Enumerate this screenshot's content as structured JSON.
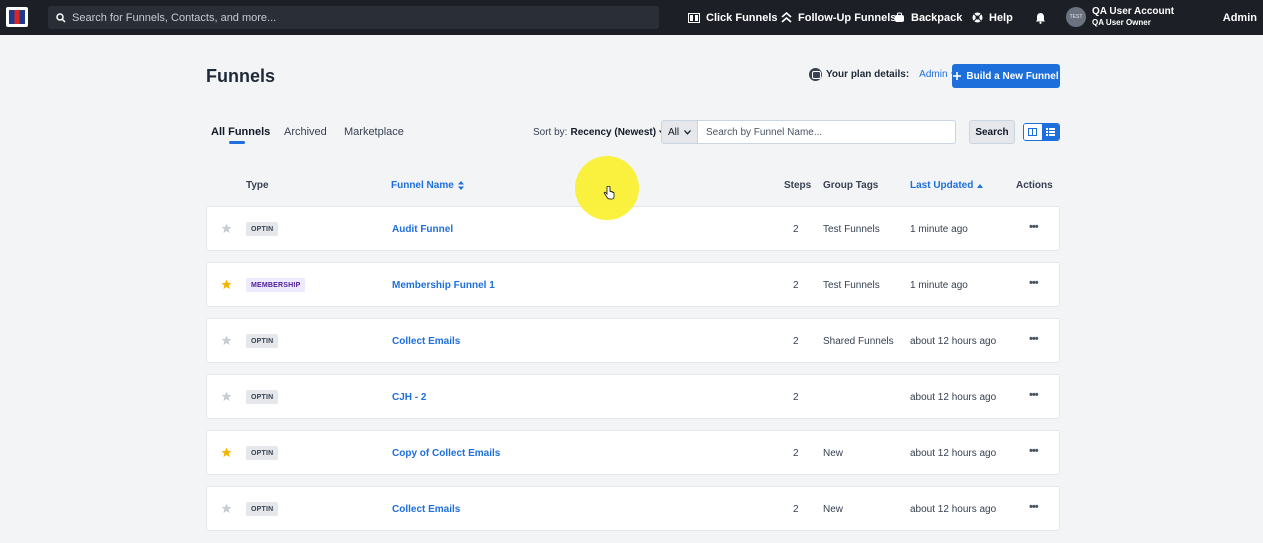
{
  "topnav": {
    "search_placeholder": "Search for Funnels, Contacts, and more...",
    "items": [
      {
        "label": "Click Funnels",
        "icon": "columns-icon"
      },
      {
        "label": "Follow-Up Funnels",
        "icon": "chevrons-up-icon"
      },
      {
        "label": "Backpack",
        "icon": "backpack-icon"
      },
      {
        "label": "Help",
        "icon": "help-icon"
      }
    ],
    "avatar_text": "TEST",
    "user_name": "QA User Account",
    "user_role": "QA User Owner",
    "admin_label": "Admin"
  },
  "header": {
    "title": "Funnels",
    "plan_label": "Your plan details:",
    "plan_value": "Admin",
    "build_button": "Build a New Funnel"
  },
  "tabs": [
    {
      "label": "All Funnels",
      "active": true
    },
    {
      "label": "Archived",
      "active": false
    },
    {
      "label": "Marketplace",
      "active": false
    }
  ],
  "toolbar": {
    "sort_label": "Sort by:",
    "sort_value": "Recency (Newest)",
    "filter_value": "All",
    "search_placeholder": "Search by Funnel Name...",
    "search_button": "Search"
  },
  "table": {
    "columns": [
      "Type",
      "Funnel Name",
      "Steps",
      "Group Tags",
      "Last Updated",
      "Actions"
    ],
    "rows": [
      {
        "starred": false,
        "type": "OPTIN",
        "name": "Audit Funnel",
        "steps": "2",
        "tags": "Test Funnels",
        "updated": "1 minute ago",
        "actions": "•••"
      },
      {
        "starred": true,
        "type": "MEMBERSHIP",
        "name": "Membership Funnel 1",
        "steps": "2",
        "tags": "Test Funnels",
        "updated": "1 minute ago",
        "actions": "•••"
      },
      {
        "starred": false,
        "type": "OPTIN",
        "name": "Collect Emails",
        "steps": "2",
        "tags": "Shared Funnels",
        "updated": "about 12 hours ago",
        "actions": "•••"
      },
      {
        "starred": false,
        "type": "OPTIN",
        "name": "CJH - 2",
        "steps": "2",
        "tags": "",
        "updated": "about 12 hours ago",
        "actions": "•••"
      },
      {
        "starred": true,
        "type": "OPTIN",
        "name": "Copy of Collect Emails",
        "steps": "2",
        "tags": "New",
        "updated": "about 12 hours ago",
        "actions": "•••"
      },
      {
        "starred": false,
        "type": "OPTIN",
        "name": "Collect Emails",
        "steps": "2",
        "tags": "New",
        "updated": "about 12 hours ago",
        "actions": "•••"
      }
    ]
  },
  "colors": {
    "nav_bg": "#1c1f26",
    "accent": "#1d6fdc",
    "star_on": "#f5b400",
    "star_off": "#c9ccd1",
    "cursor_highlight": "#faf01e"
  }
}
